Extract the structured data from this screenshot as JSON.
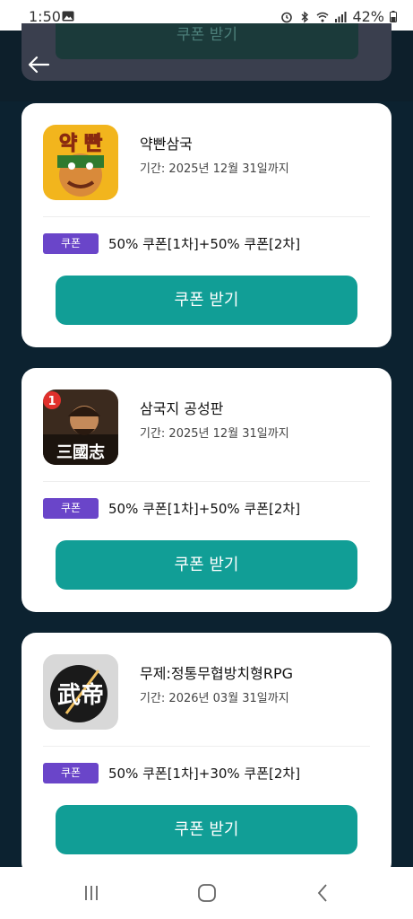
{
  "status_bar": {
    "time": "1:50",
    "battery": "42%"
  },
  "header": {
    "ghost_button_label": "쿠폰 받기"
  },
  "cards": [
    {
      "title": "약빤삼국",
      "period": "기간: 2025년 12월 31일까지",
      "coupon_badge": "쿠폰",
      "coupon_text": "50% 쿠폰[1차]+50% 쿠폰[2차]",
      "button_label": "쿠폰 받기",
      "icon_text": "약 빤"
    },
    {
      "title": "삼국지 공성판",
      "period": "기간: 2025년 12월 31일까지",
      "coupon_badge": "쿠폰",
      "coupon_text": "50% 쿠폰[1차]+50% 쿠폰[2차]",
      "button_label": "쿠폰 받기",
      "icon_badge": "1",
      "icon_text": "三國志"
    },
    {
      "title": "무제:정통무협방치형RPG",
      "period": "기간: 2026년 03월 31일까지",
      "coupon_badge": "쿠폰",
      "coupon_text": "50% 쿠폰[1차]+30% 쿠폰[2차]",
      "button_label": "쿠폰 받기",
      "icon_text": "武帝"
    }
  ],
  "colors": {
    "accent_button": "#119e96",
    "badge": "#6a45c9",
    "background": "#0c2230"
  }
}
